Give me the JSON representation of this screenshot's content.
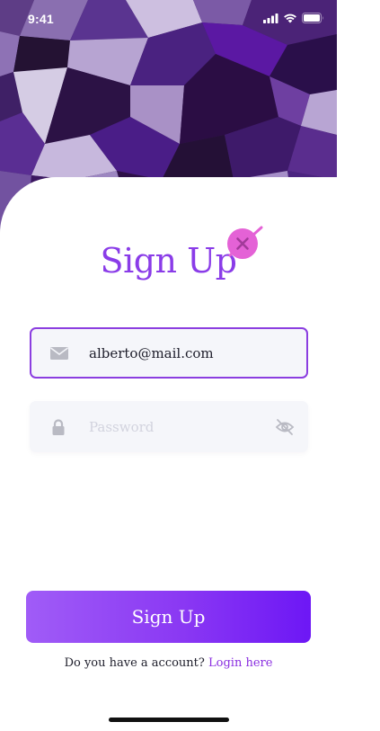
{
  "status_bar": {
    "time": "9:41",
    "icons": [
      "cellular-signal-icon",
      "wifi-icon",
      "battery-icon"
    ]
  },
  "header": {
    "title": "Sign Up",
    "badge_icon": "close-icon"
  },
  "form": {
    "email": {
      "icon": "mail-icon",
      "value": "alberto@mail.com"
    },
    "password": {
      "icon": "lock-icon",
      "placeholder": "Password",
      "value": "",
      "toggle_icon": "eye-off-icon"
    },
    "submit_label": "Sign Up"
  },
  "footer": {
    "prompt": "Do you have a account?",
    "link_label": "Login here"
  },
  "colors": {
    "accent": "#8a3ce8",
    "button_gradient_start": "#a05cf7",
    "button_gradient_end": "#6d17f5",
    "field_background": "#f5f6fa",
    "badge": "#e462d6"
  }
}
